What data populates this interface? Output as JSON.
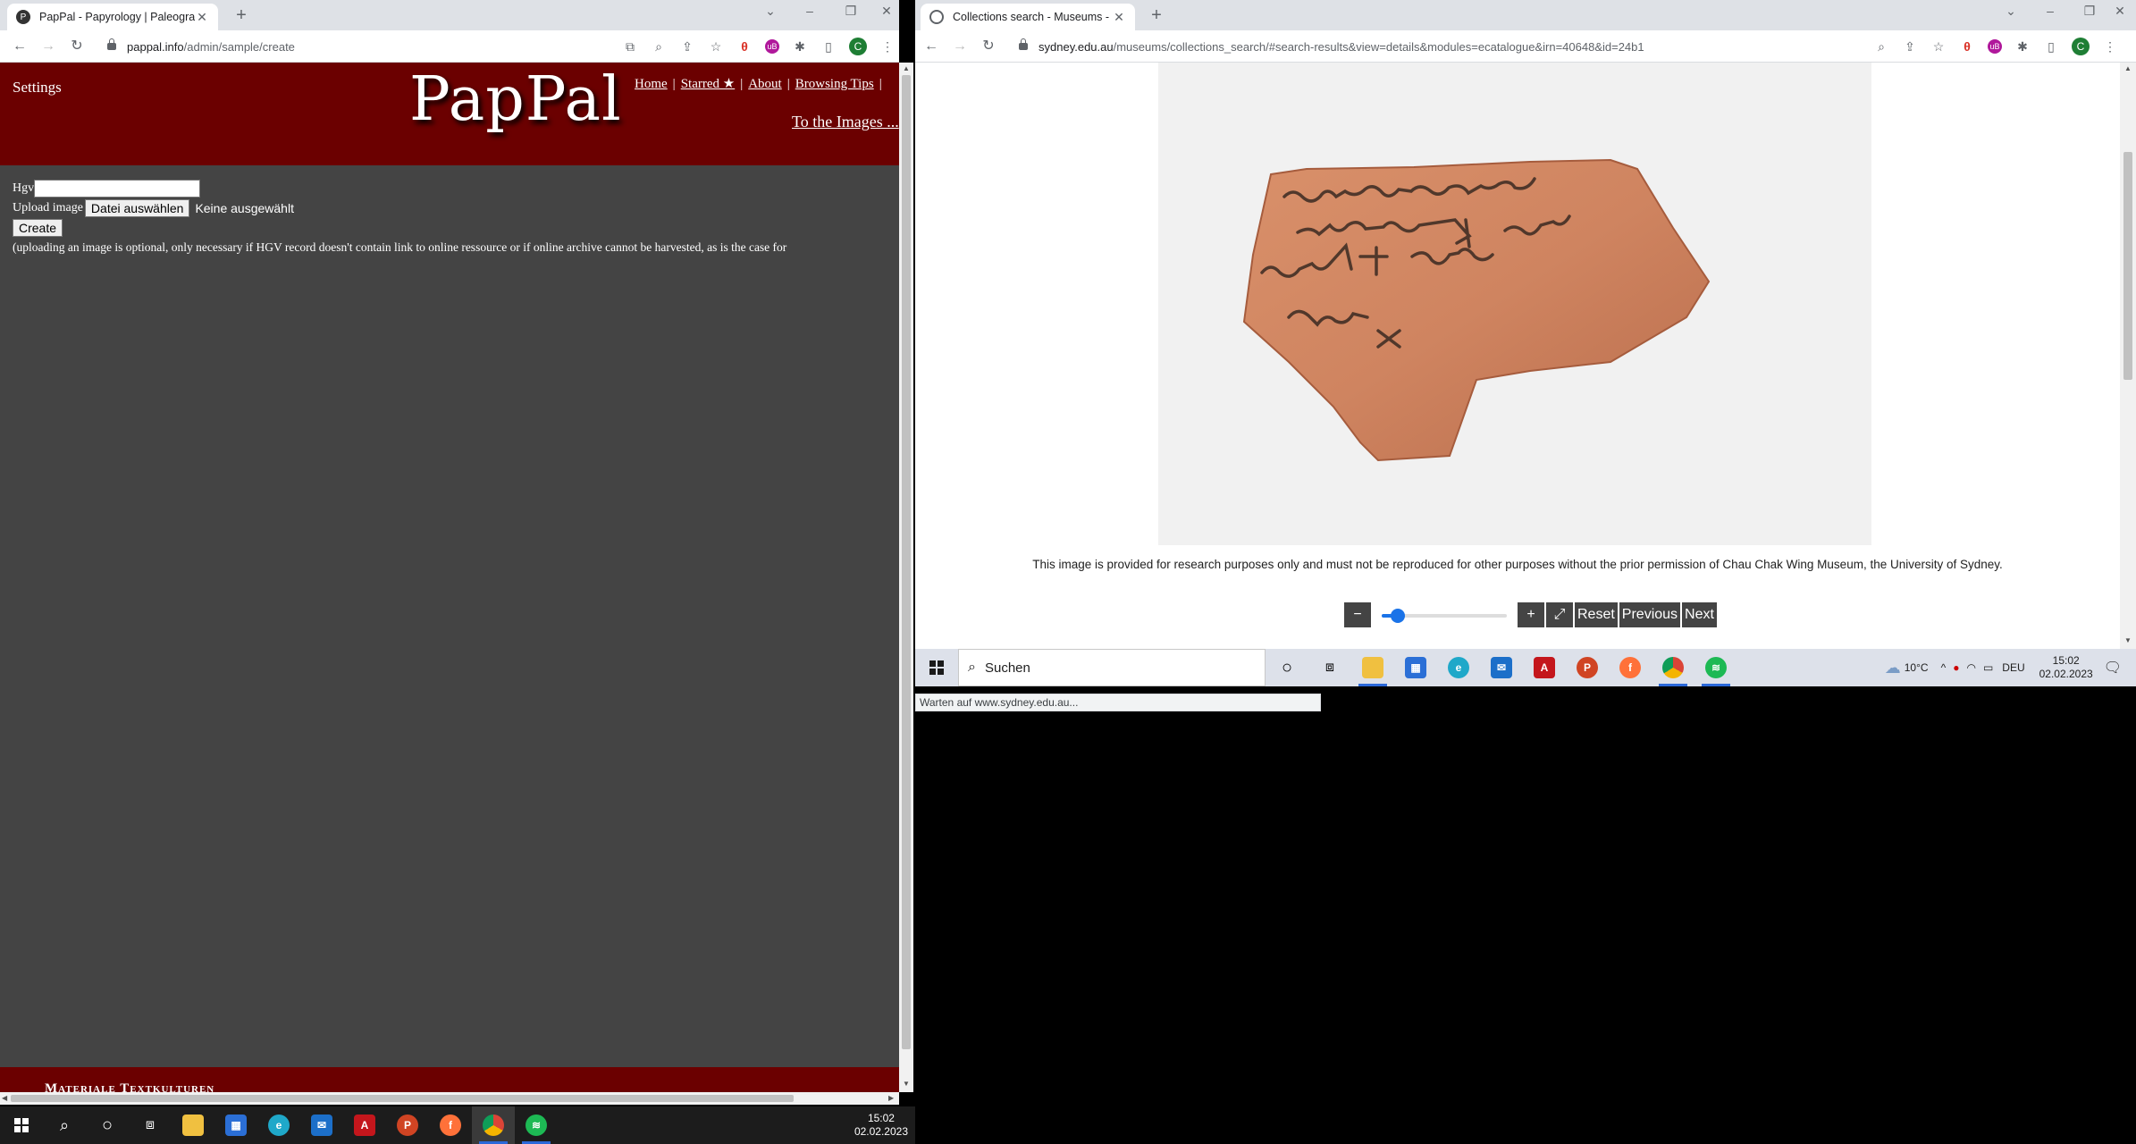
{
  "left_window": {
    "tab_title": "PapPal - Papyrology | Paleograph",
    "url_host": "pappal.info",
    "url_path": "/admin/sample/create",
    "header": {
      "settings_label": "Settings",
      "logo": "PapPal",
      "nav": [
        "Home",
        "Starred ★",
        "About",
        "Browsing Tips"
      ],
      "images_link": "To the Images ..."
    },
    "form": {
      "hgv_label": "Hgv",
      "upload_label": "Upload image",
      "file_button": "Datei auswählen",
      "no_file": "Keine ausgewählt",
      "create_button": "Create",
      "note": "(uploading an image is optional, only necessary if HGV record doesn't contain link to online ressource or if online archive cannot be harvested, as is the case for"
    },
    "footer_text": "Materiale Textkulturen"
  },
  "right_window": {
    "tab_title": "Collections search - Museums - T",
    "url_host": "sydney.edu.au",
    "url_path": "/museums/collections_search/#search-results&view=details&modules=ecatalogue&irn=40648&id=24b1",
    "caption": "This image is provided for research purposes only and must not be reproduced for other purposes without the prior permission of Chau Chak Wing Museum, the University of Sydney.",
    "controls": {
      "zoom_out": "−",
      "zoom_in": "+",
      "fullscreen": "⤢",
      "reset": "Reset",
      "previous": "Previous",
      "next": "Next",
      "zoom_level": 0.1
    },
    "status": "Warten auf www.sydney.edu.au..."
  },
  "taskbar_right": {
    "search_placeholder": "Suchen",
    "weather": "10°C",
    "language": "DEU",
    "time": "15:02",
    "date": "02.02.2023"
  },
  "taskbar_bottom": {
    "time": "15:02",
    "date": "02.02.2023"
  },
  "colors": {
    "pappal_header": "#6b0000",
    "pappal_body": "#444444",
    "accent_blue": "#1a73e8"
  }
}
